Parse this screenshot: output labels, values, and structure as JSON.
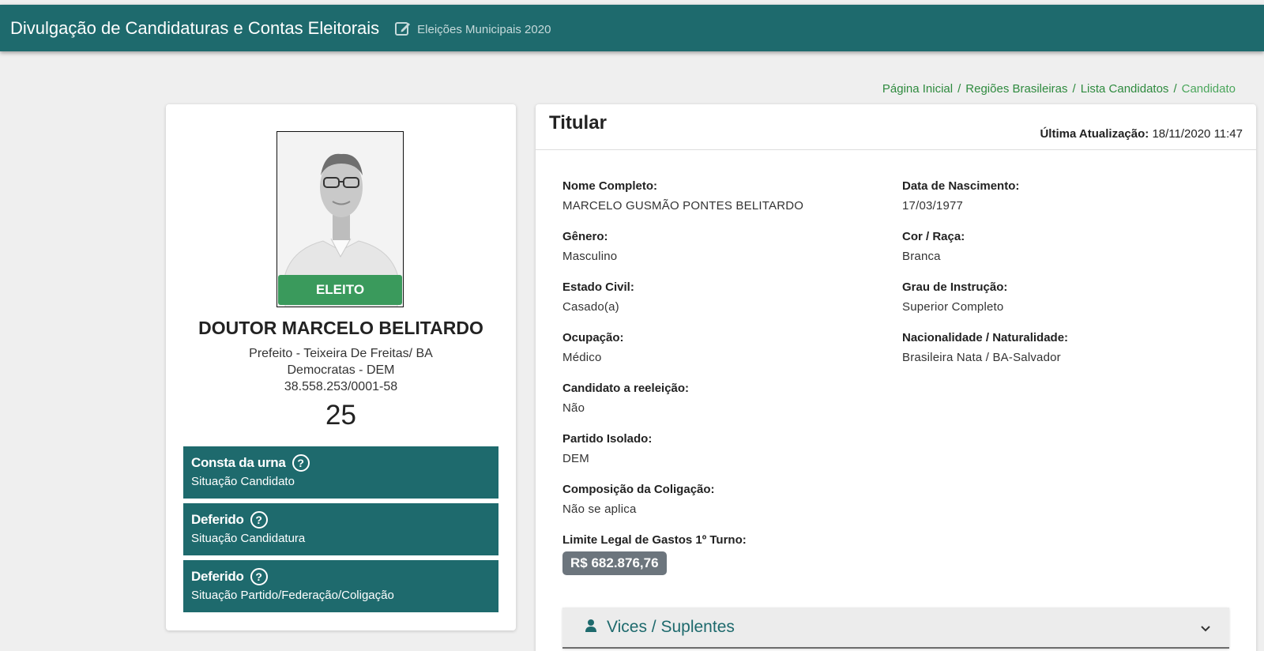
{
  "header": {
    "app_title": "Divulgação de Candidaturas e Contas Eleitorais",
    "subtitle": "Eleições Municipais 2020"
  },
  "breadcrumb": [
    "Página Inicial",
    "Regiões Brasileiras",
    "Lista Candidatos",
    "Candidato"
  ],
  "candidate": {
    "badge": "ELEITO",
    "name": "DOUTOR MARCELO BELITARDO",
    "office": "Prefeito - Teixeira De Freitas/ BA",
    "party": "Democratas - DEM",
    "cnpj": "38.558.253/0001-58",
    "number": "25",
    "statuses": [
      {
        "title": "Consta da urna",
        "subtitle": "Situação Candidato"
      },
      {
        "title": "Deferido",
        "subtitle": "Situação Candidatura"
      },
      {
        "title": "Deferido",
        "subtitle": "Situação Partido/Federação/Coligação"
      }
    ]
  },
  "details": {
    "title": "Titular",
    "updated_label": "Última Atualização:",
    "updated_value": "18/11/2020 11:47",
    "fields_left": [
      {
        "label": "Nome Completo:",
        "value": "MARCELO GUSMÃO PONTES BELITARDO"
      },
      {
        "label": "Gênero:",
        "value": "Masculino"
      },
      {
        "label": "Estado Civil:",
        "value": "Casado(a)"
      },
      {
        "label": "Ocupação:",
        "value": "Médico"
      },
      {
        "label": "Candidato a reeleição:",
        "value": "Não"
      },
      {
        "label": "Partido Isolado:",
        "value": "DEM"
      },
      {
        "label": "Composição da Coligação:",
        "value": "Não se aplica"
      }
    ],
    "fields_right": [
      {
        "label": "Data de Nascimento:",
        "value": "17/03/1977"
      },
      {
        "label": "Cor / Raça:",
        "value": "Branca"
      },
      {
        "label": "Grau de Instrução:",
        "value": "Superior Completo"
      },
      {
        "label": "Nacionalidade / Naturalidade:",
        "value": "Brasileira Nata / BA-Salvador"
      }
    ],
    "limit_label": "Limite Legal de Gastos 1º Turno:",
    "limit_value": "R$ 682.876,76",
    "accordion_label": "Vices / Suplentes"
  }
}
